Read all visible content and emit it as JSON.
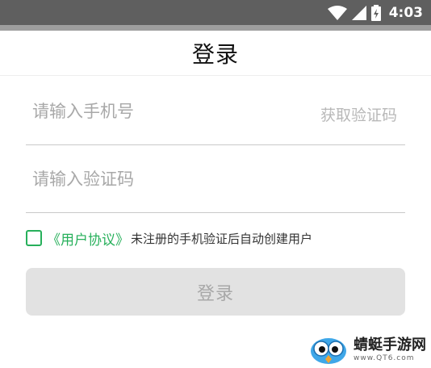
{
  "status_bar": {
    "time": "4:03",
    "icons": [
      "wifi-icon",
      "signal-icon",
      "battery-icon"
    ],
    "color": "#5f5f5f"
  },
  "header": {
    "title": "登录"
  },
  "form": {
    "phone_placeholder": "请输入手机号",
    "get_code_label": "获取验证码",
    "code_placeholder": "请输入验证码",
    "agreement_link": "《用户协议》",
    "agreement_note": "未注册的手机验证后自动创建用户",
    "login_label": "登录",
    "agreement_checked": false
  },
  "colors": {
    "accent": "#27b05b",
    "button_disabled_bg": "#e2e2e2",
    "button_disabled_text": "#a8a8a8",
    "placeholder": "#a8a8a8"
  },
  "watermark": {
    "name": "蜻蜓手游网",
    "domain": "www.QT6.com"
  }
}
